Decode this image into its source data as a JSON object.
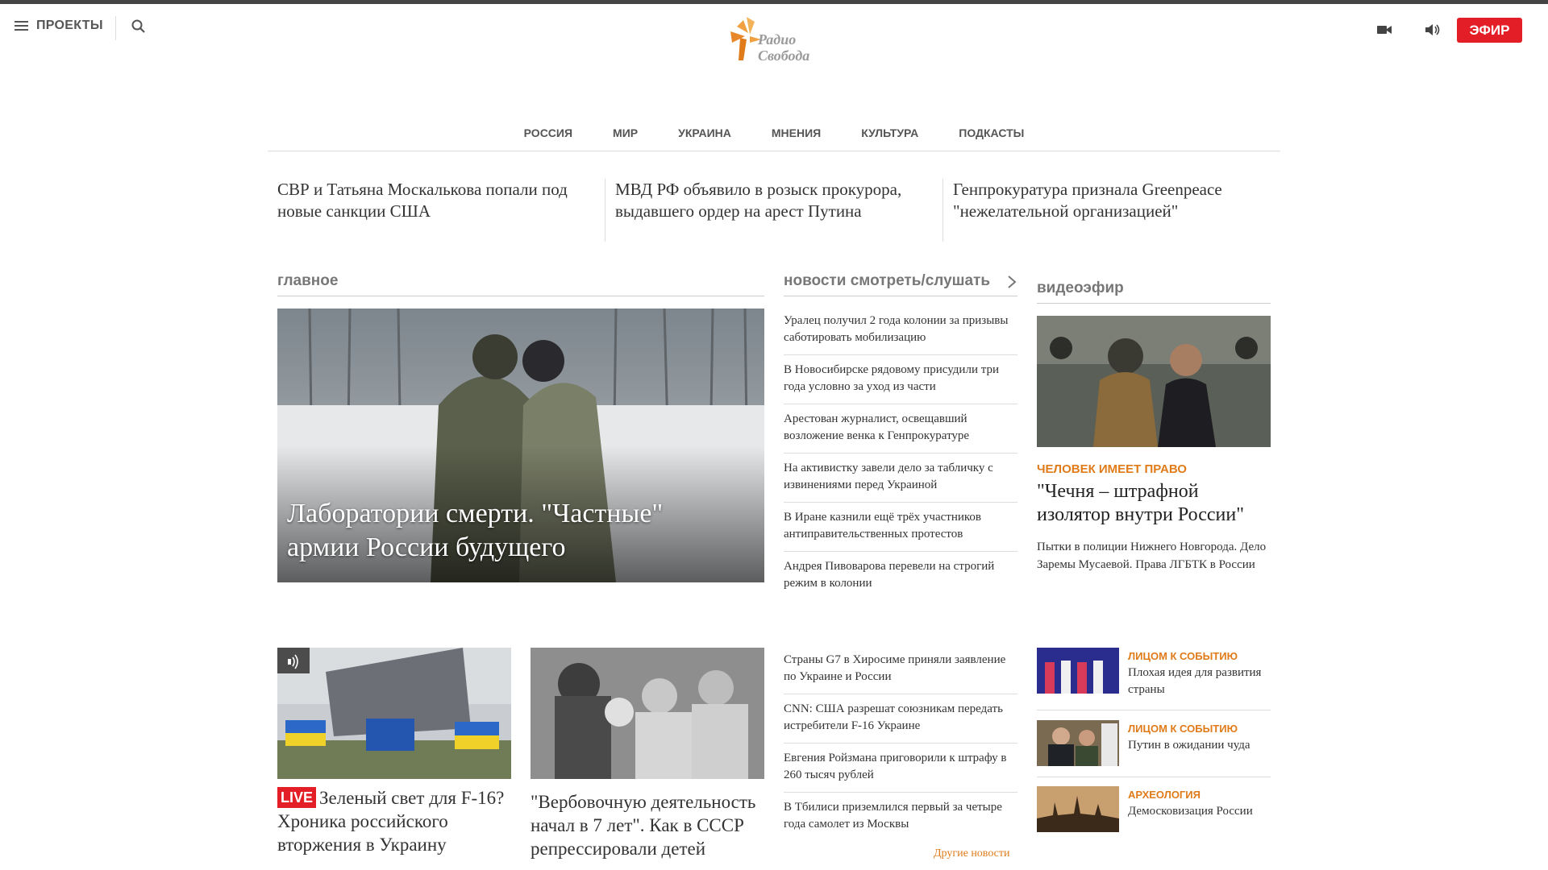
{
  "header": {
    "menu_label": "ПРОЕКТЫ",
    "logo_text_top": "Радио",
    "logo_text_bottom": "Свобода",
    "efir_label": "ЭФИР",
    "icons": [
      "menu-icon",
      "search-icon",
      "video-camera-icon",
      "speaker-icon"
    ]
  },
  "nav": {
    "items": [
      "РОССИЯ",
      "МИР",
      "УКРАИНА",
      "МНЕНИЯ",
      "КУЛЬТУРА",
      "ПОДКАСТЫ"
    ]
  },
  "top_stories": [
    "СВР и Татьяна Москалькова попали под новые санкции США",
    "МВД РФ объявило в розыск прокурора, выдавшего ордер на арест Путина",
    "Генпрокуратура признала Greenpeace \"нежелательной организацией\""
  ],
  "main": {
    "section_title": "главное",
    "hero_title": "Лаборатории смерти. \"Частные\" армии России будущего",
    "cards": [
      {
        "live": "LIVE",
        "title": "Зеленый свет для F-16? Хроника российского вторжения в Украину"
      },
      {
        "title": "\"Вербовочную деятельность начал в 7 лет\". Как в СССР репрессировали детей"
      }
    ]
  },
  "news": {
    "section_title": "новости смотреть/слушать",
    "items": [
      "Уралец получил 2 года колонии за призывы саботировать мобилизацию",
      "В Новосибирске рядовому присудили три года условно за уход из части",
      "Арестован журналист, освещавший возложение венка к Генпрокуратуре",
      "На активистку завели дело за табличку с извинениями перед Украиной",
      "В Иране казнили ещё трёх участников антиправительственных протестов",
      "Андрея Пивоварова перевели на строгий режим в колонии",
      "Страны G7 в Хиросиме приняли заявление по Украине и России",
      "CNN: США разрешат союзникам передать истребители F-16 Украине",
      "Евгения Ройзмана приговорили к штрафу в 260 тысяч рублей",
      "В Тбилиси приземлился первый за четыре года самолет из Москвы"
    ],
    "more_label": "Другие новости"
  },
  "video": {
    "section_title": "видеоэфир",
    "kicker": "ЧЕЛОВЕК ИМЕЕТ ПРАВО",
    "title": "\"Чечня – штрафной изолятор внутри России\"",
    "desc": "Пытки в полиции Нижнего Новгорода. Дело Заремы Мусаевой. Права ЛГБТК в России",
    "minis": [
      {
        "kicker": "ЛИЦОМ К СОБЫТИЮ",
        "title": "Плохая идея для развития страны"
      },
      {
        "kicker": "ЛИЦОМ К СОБЫТИЮ",
        "title": "Путин в ожидании чуда"
      },
      {
        "kicker": "АРХЕОЛОГИЯ",
        "title": "Демосковизация России"
      }
    ]
  },
  "colors": {
    "accent_red": "#e41e26",
    "kicker_orange": "#e07b1a"
  }
}
